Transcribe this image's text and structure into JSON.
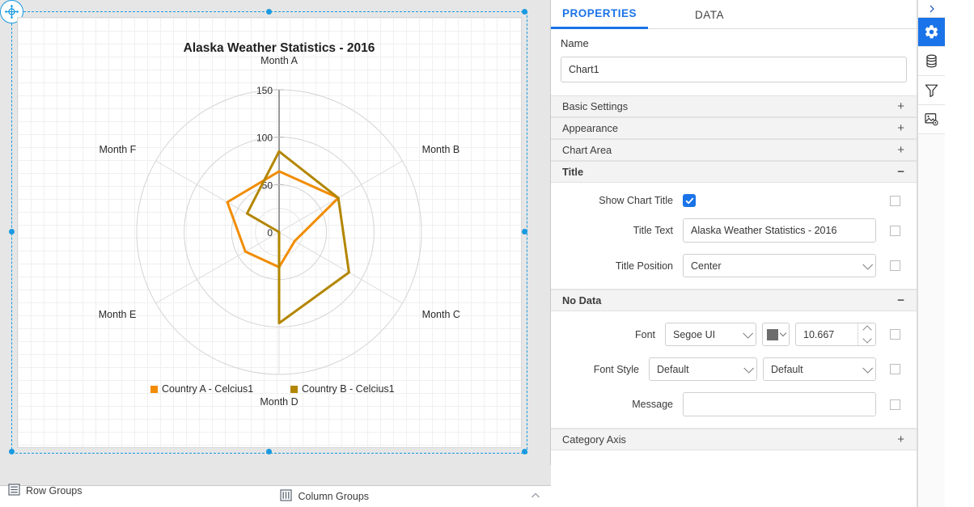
{
  "designer": {
    "move_grip_icon": "move-grip-icon",
    "group_bar": {
      "row_groups_label": "Row Groups",
      "row_groups_icon": "row-groups-icon",
      "column_groups_label": "Column Groups",
      "column_groups_icon": "column-groups-icon",
      "collapse_icon": "chevron-up-icon"
    }
  },
  "chart_data": {
    "type": "radar",
    "title": "Alaska Weather Statistics - 2016",
    "categories": [
      "Month A",
      "Month B",
      "Month C",
      "Month D",
      "Month E",
      "Month F"
    ],
    "radial_ticks": [
      0,
      50,
      100,
      150
    ],
    "rlim": [
      0,
      150
    ],
    "grid": true,
    "legend_position": "bottom",
    "series": [
      {
        "name": "Country A - Celcius1",
        "color": "#F28C00",
        "values": [
          64,
          72,
          19,
          37,
          41,
          63
        ]
      },
      {
        "name": "Country B - Celcius1",
        "color": "#B38600",
        "values": [
          85,
          72,
          85,
          96,
          0,
          39
        ]
      }
    ]
  },
  "panel": {
    "tabs": [
      {
        "label": "PROPERTIES",
        "active": true
      },
      {
        "label": "DATA",
        "active": false
      }
    ],
    "name": {
      "label": "Name",
      "value": "Chart1"
    },
    "sections": [
      {
        "label": "Basic Settings",
        "sign": "+",
        "open": false
      },
      {
        "label": "Appearance",
        "sign": "+",
        "open": false
      },
      {
        "label": "Chart Area",
        "sign": "+",
        "open": false
      },
      {
        "label": "Title",
        "sign": "−",
        "open": true
      },
      {
        "label": "No Data",
        "sign": "−",
        "open": true
      },
      {
        "label": "Category Axis",
        "sign": "+",
        "open": false
      }
    ],
    "title_section": {
      "show_chart_title_label": "Show Chart Title",
      "show_chart_title_checked": true,
      "title_text_label": "Title Text",
      "title_text_value": "Alaska Weather Statistics - 2016",
      "title_position_label": "Title Position",
      "title_position_value": "Center"
    },
    "no_data_section": {
      "font_label": "Font",
      "font_family_value": "Segoe UI",
      "font_color": "#6d6d6d",
      "font_size_value": "10.667",
      "font_style_label": "Font Style",
      "font_style_value_1": "Default",
      "font_style_value_2": "Default",
      "message_label": "Message",
      "message_value": ""
    },
    "rail": [
      {
        "icon": "chevron-right-icon",
        "active": false
      },
      {
        "icon": "gear-icon",
        "active": true
      },
      {
        "icon": "database-icon",
        "active": false
      },
      {
        "icon": "filter-funnel-icon",
        "active": false
      },
      {
        "icon": "image-settings-icon",
        "active": false
      }
    ],
    "accent_color": "#1a73e8"
  }
}
